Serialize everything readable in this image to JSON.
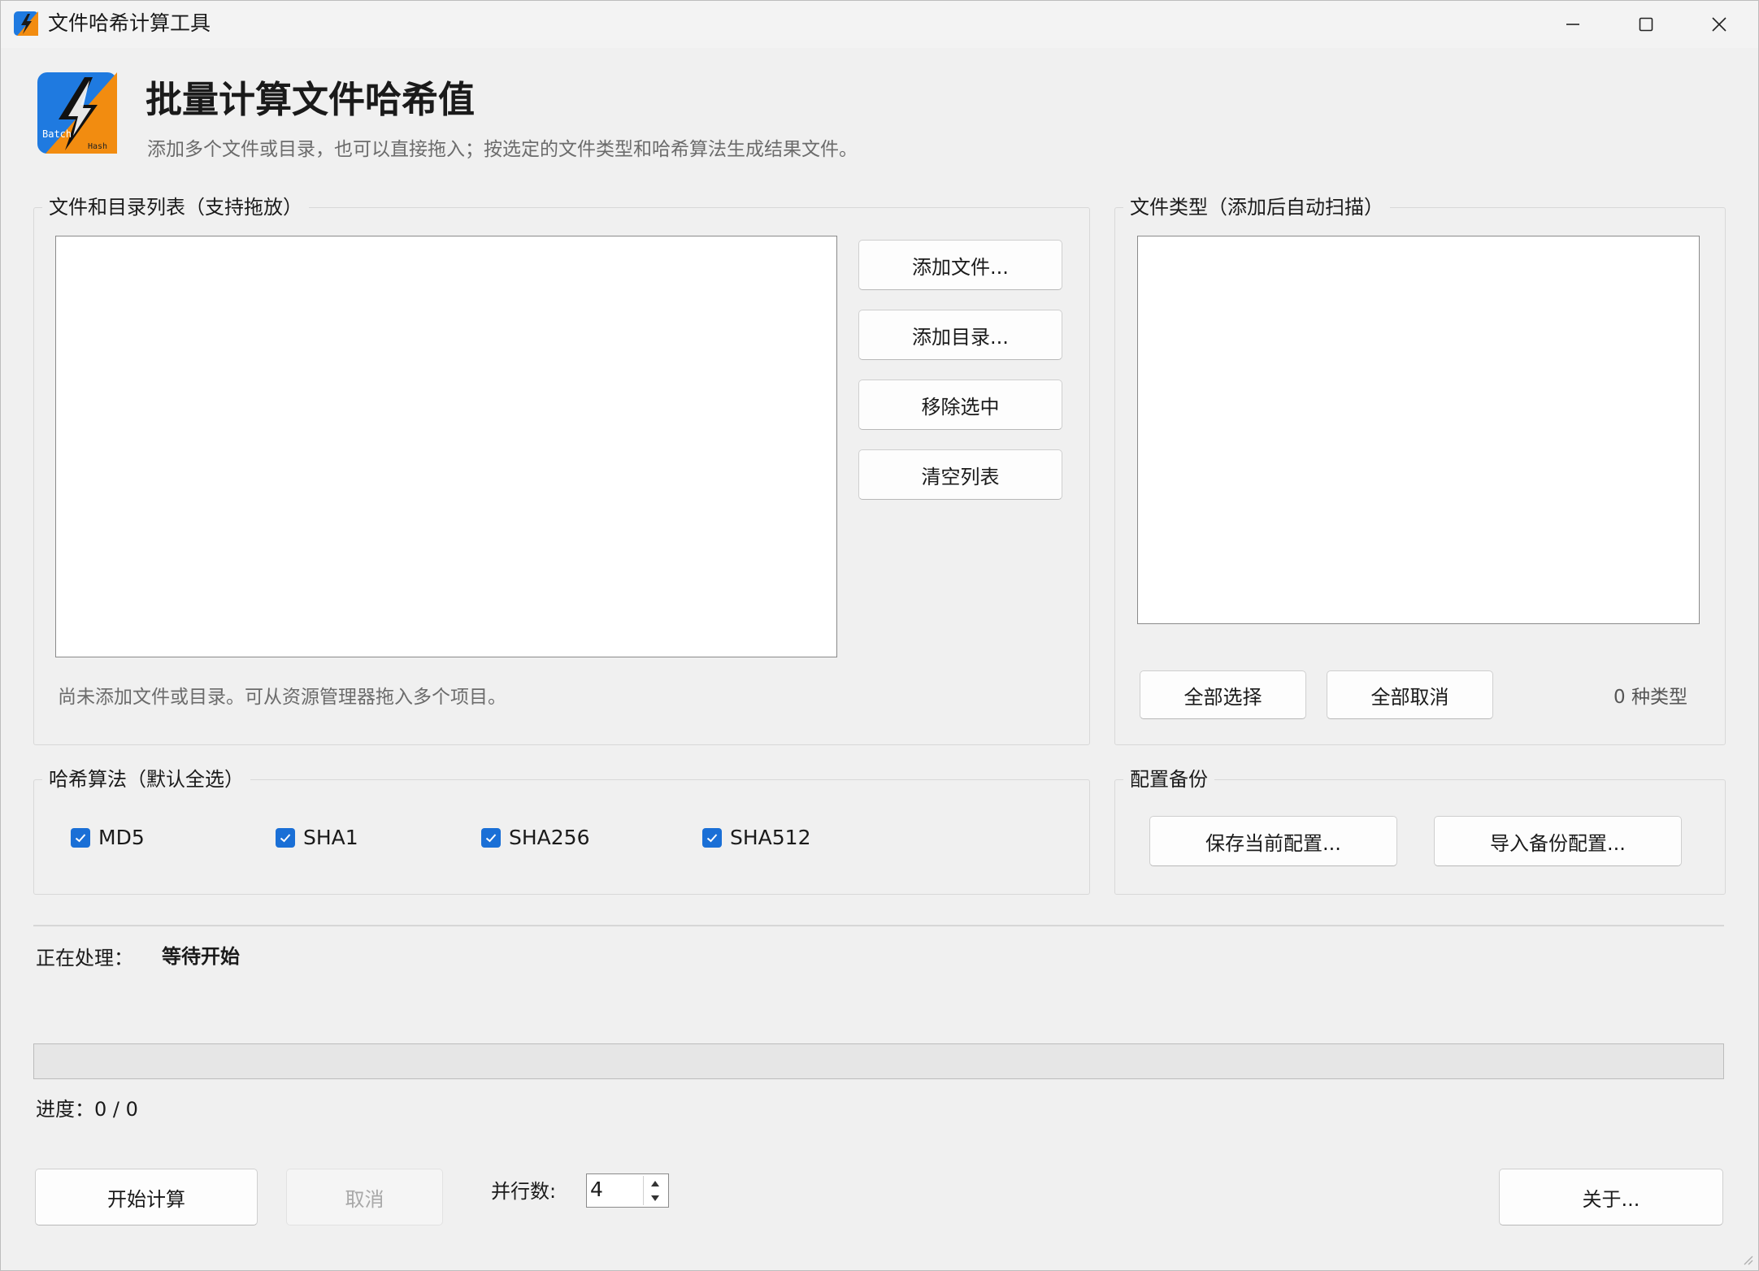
{
  "window": {
    "title": "文件哈希计算工具",
    "controls": {
      "minimize": "minimize",
      "maximize": "maximize",
      "close": "close"
    }
  },
  "header": {
    "title": "批量计算文件哈希值",
    "subtitle": "添加多个文件或目录，也可以直接拖入；按选定的文件类型和哈希算法生成结果文件。",
    "logo_text": [
      "Batch",
      "Hash"
    ]
  },
  "files_panel": {
    "label": "文件和目录列表（支持拖放）",
    "buttons": [
      "添加文件...",
      "添加目录...",
      "移除选中",
      "清空列表"
    ],
    "empty_hint": "尚未添加文件或目录。可从资源管理器拖入多个项目。"
  },
  "types_panel": {
    "label": "文件类型（添加后自动扫描）",
    "select_all": "全部选择",
    "deselect_all": "全部取消",
    "count_text": "0 种类型"
  },
  "hash_panel": {
    "label": "哈希算法（默认全选）",
    "algorithms": [
      {
        "name": "MD5",
        "checked": true
      },
      {
        "name": "SHA1",
        "checked": true
      },
      {
        "name": "SHA256",
        "checked": true
      },
      {
        "name": "SHA512",
        "checked": true
      }
    ]
  },
  "backup_panel": {
    "label": "配置备份",
    "save": "保存当前配置...",
    "import": "导入备份配置..."
  },
  "status": {
    "processing_label": "正在处理：",
    "processing_value": "等待开始",
    "progress_text": "进度：0 / 0",
    "progress_fraction": 0
  },
  "footer": {
    "start": "开始计算",
    "cancel": "取消",
    "parallel_label": "并行数:",
    "parallel_value": "4",
    "about": "关于..."
  },
  "colors": {
    "accent": "#1a6fd6",
    "logo_blue": "#1f7ae0",
    "logo_orange": "#f28c10"
  }
}
